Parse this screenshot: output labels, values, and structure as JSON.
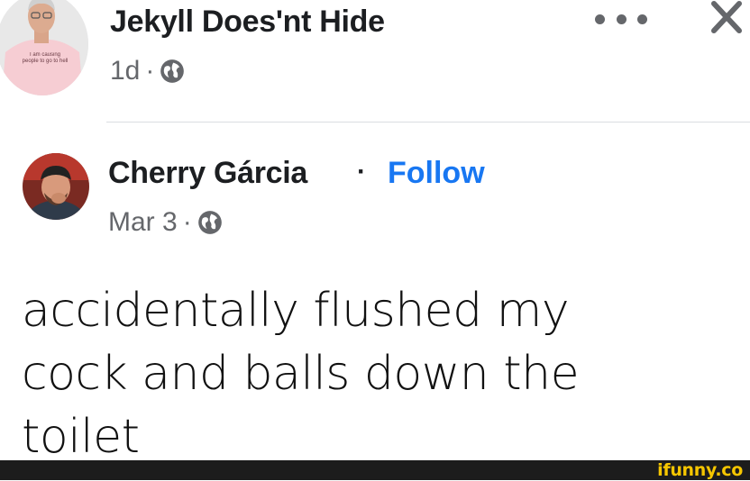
{
  "top_post": {
    "author": "Jekyll Does'nt Hide",
    "time": "1d",
    "separator": "·",
    "avatar_shirt_text": "I am causing people to go to hell",
    "icons": {
      "audience": "globe-icon",
      "more": "more-horizontal-icon",
      "close": "close-icon"
    }
  },
  "shared_post": {
    "author": "Cherry Gárcia",
    "separator_bullet": "·",
    "follow_label": "Follow",
    "time": "Mar 3",
    "separator": "·",
    "body_lines": [
      "accidentally flushed my",
      "cock and balls down the",
      "toilet"
    ],
    "icons": {
      "audience": "globe-icon"
    }
  },
  "footer": {
    "brand": "ifunny.co"
  },
  "colors": {
    "link": "#1877f2",
    "meta": "#65676b",
    "brand": "#f6c600",
    "footer_bg": "#1c1c1c"
  }
}
